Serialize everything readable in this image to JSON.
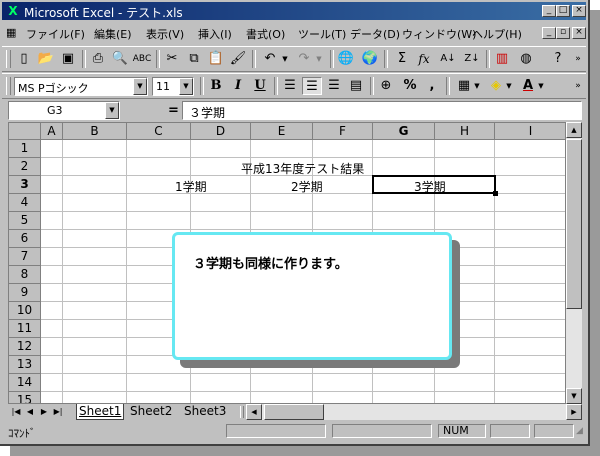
{
  "window": {
    "title": "Microsoft Excel - テスト.xls"
  },
  "menu": {
    "items": [
      "ファイル(F)",
      "編集(E)",
      "表示(V)",
      "挿入(I)",
      "書式(O)",
      "ツール(T)",
      "データ(D)",
      "ウィンドウ(W)",
      "ヘルプ(H)"
    ]
  },
  "format_toolbar": {
    "font_name": "MS Pゴシック",
    "font_size": "11"
  },
  "formula_bar": {
    "name_box": "G3",
    "equals": "=",
    "content": "３学期"
  },
  "sheet": {
    "columns": [
      "A",
      "B",
      "C",
      "D",
      "E",
      "F",
      "G",
      "H",
      "I"
    ],
    "rows": [
      "1",
      "2",
      "3",
      "4",
      "5",
      "6",
      "7",
      "8",
      "9",
      "10",
      "11",
      "12",
      "13",
      "14",
      "15"
    ],
    "cells": {
      "title": "平成13年度テスト結果",
      "term1": "1学期",
      "term2": "2学期",
      "term3": "3学期"
    },
    "tabs": [
      "Sheet1",
      "Sheet2",
      "Sheet3"
    ],
    "active_tab": "Sheet1"
  },
  "status": {
    "mode": "ｺﾏﾝﾄﾞ",
    "num": "NUM"
  },
  "callout": {
    "text": "３学期も同様に作ります。"
  },
  "colors": {
    "callout_border": "#66e8f2",
    "titlebar": "#0a246a",
    "accent_red": "#cc0000"
  }
}
